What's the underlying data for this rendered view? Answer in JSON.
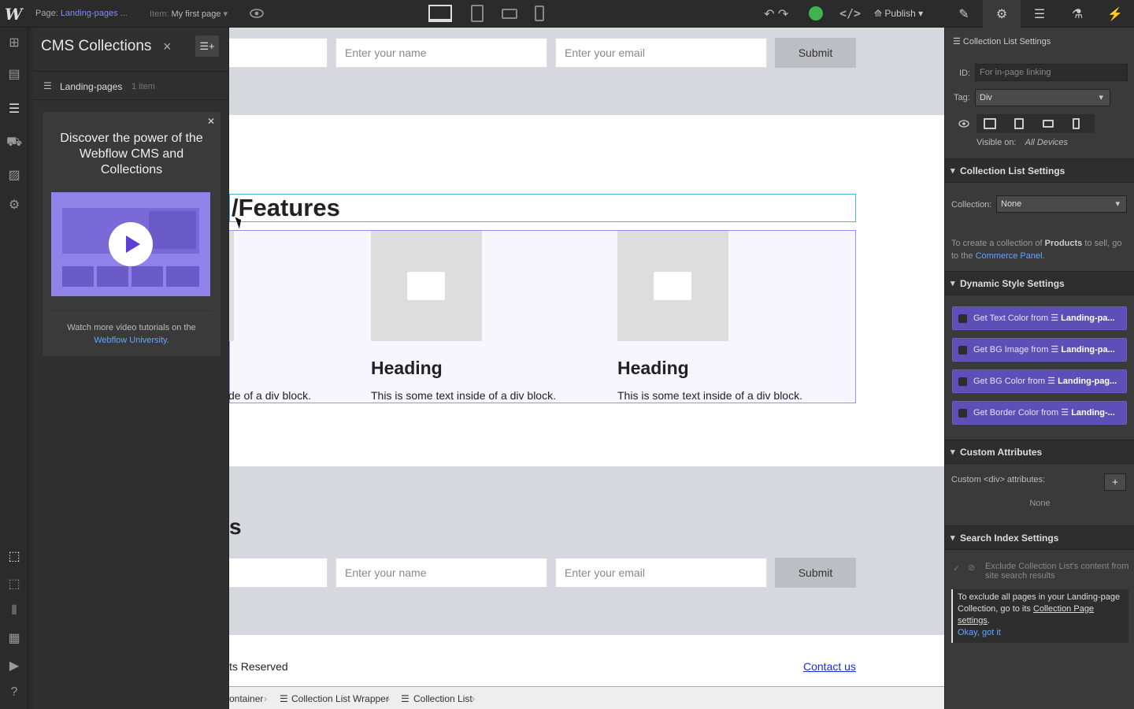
{
  "topbar": {
    "logo": "W",
    "page_prefix": "Page: ",
    "page_name": "Landing-pages ...",
    "item_prefix": "Item: ",
    "item_name": "My first page",
    "publish_label": "Publish",
    "code_label": "</>"
  },
  "right_tabs": [
    "brush-icon",
    "gear-icon",
    "navigator-icon",
    "interactions-icon",
    "lightning-icon"
  ],
  "cms": {
    "title": "CMS Collections",
    "collection_name": "Landing-pages",
    "collection_count": "1 item",
    "promo_title": "Discover the power of the Webflow CMS and Collections",
    "promo_watch": "Watch more video tutorials on the",
    "promo_link": "Webflow University."
  },
  "canvas": {
    "form_top": {
      "name_placeholder": "Enter your name",
      "email_placeholder": "Enter your email",
      "submit": "Submit"
    },
    "features_title": "/Features",
    "cards": [
      {
        "heading": "",
        "text": "de of a div block."
      },
      {
        "heading": "Heading",
        "text": "This is some text inside of a div block."
      },
      {
        "heading": "Heading",
        "text": "This is some text inside of a div block."
      }
    ],
    "section2_title": "s",
    "form_bottom": {
      "name_placeholder": "Enter your name",
      "email_placeholder": "Enter your email",
      "submit": "Submit"
    },
    "footer_text": "ts Reserved",
    "contact": "Contact us"
  },
  "breadcrumbs": [
    "ontainer",
    "Collection List Wrapper",
    "Collection List"
  ],
  "settings": {
    "header": "Collection List Settings",
    "id_label": "ID:",
    "id_placeholder": "For in-page linking",
    "tag_label": "Tag:",
    "tag_value": "Div",
    "visible_label": "Visible on:",
    "visible_value": "All Devices",
    "section_collection": "Collection List Settings",
    "collection_label": "Collection:",
    "collection_value": "None",
    "commerce_note_a": "To create a collection of ",
    "commerce_note_b": "Products",
    "commerce_note_c": " to sell, go to the ",
    "commerce_link": "Commerce Panel",
    "section_dynamic": "Dynamic Style Settings",
    "dynamic": [
      {
        "label": "Get Text Color from",
        "source": "Landing-pa..."
      },
      {
        "label": "Get BG Image from",
        "source": "Landing-pa..."
      },
      {
        "label": "Get BG Color from",
        "source": "Landing-pag..."
      },
      {
        "label": "Get Border Color from",
        "source": "Landing-..."
      }
    ],
    "section_custom": "Custom Attributes",
    "custom_label": "Custom <div> attributes:",
    "custom_value": "None",
    "section_search": "Search Index Settings",
    "exclude_text": "Exclude Collection List's content from site search results",
    "info_a": "To exclude all pages in your Landing-page Collection, go to its ",
    "info_link": "Collection Page settings",
    "info_b": ".",
    "info_ok": "Okay, got it"
  }
}
